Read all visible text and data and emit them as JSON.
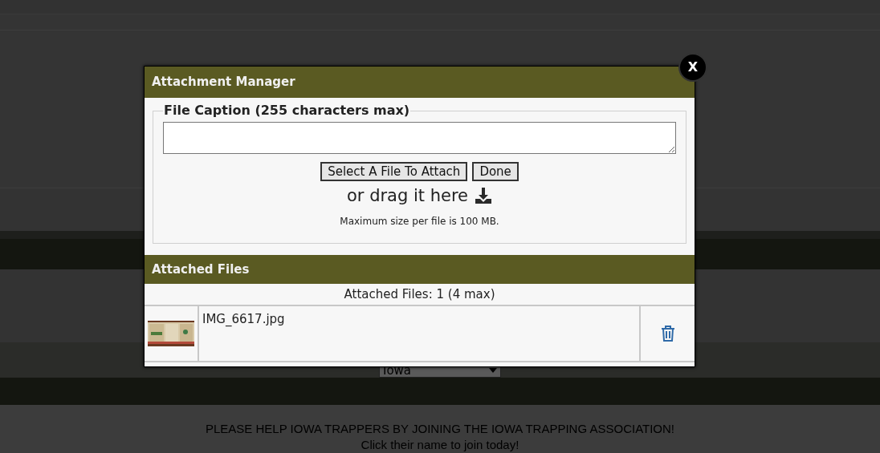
{
  "background_page": {
    "state_select": {
      "value": "Iowa"
    },
    "banner": {
      "text": "PLEASE HELP IOWA TRAPPERS BY JOINING THE IOWA TRAPPING ASSOCIATION!",
      "link": "Click their name to join today!"
    }
  },
  "dialog": {
    "title": "Attachment Manager",
    "close_label": "X",
    "caption": {
      "legend": "File Caption (255 characters max)"
    },
    "buttons": [
      "Select A File To Attach",
      "Done"
    ],
    "drop_hint": "or drag it here",
    "size_note": "Maximum size per file is 100 MB.",
    "attached": {
      "title": "Attached Files",
      "count": "Attached Files: 1 (4 max)",
      "files": [
        {
          "name": "IMG_6617.jpg"
        }
      ]
    }
  }
}
